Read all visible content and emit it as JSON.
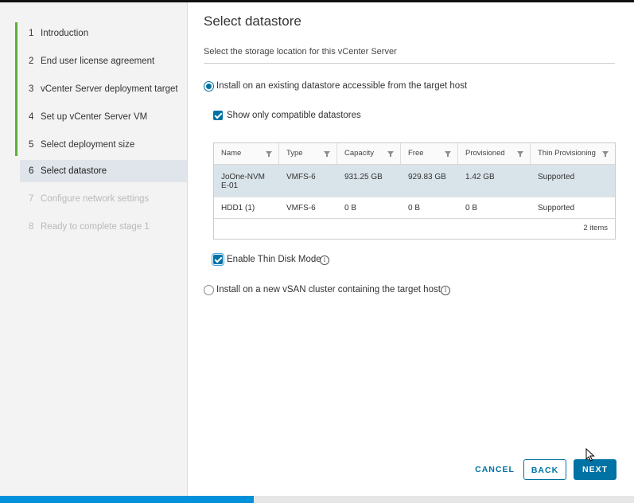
{
  "steps": [
    {
      "num": "1",
      "label": "Introduction",
      "state": "done"
    },
    {
      "num": "2",
      "label": "End user license agreement",
      "state": "done"
    },
    {
      "num": "3",
      "label": "vCenter Server deployment target",
      "state": "done"
    },
    {
      "num": "4",
      "label": "Set up vCenter Server VM",
      "state": "done"
    },
    {
      "num": "5",
      "label": "Select deployment size",
      "state": "done"
    },
    {
      "num": "6",
      "label": "Select datastore",
      "state": "active"
    },
    {
      "num": "7",
      "label": "Configure network settings",
      "state": "future"
    },
    {
      "num": "8",
      "label": "Ready to complete stage 1",
      "state": "future"
    }
  ],
  "page": {
    "title": "Select datastore",
    "subtitle": "Select the storage location for this vCenter Server"
  },
  "options": {
    "existing_datastore": {
      "label": "Install on an existing datastore accessible from the target host",
      "selected": true
    },
    "compatible_only": {
      "label": "Show only compatible datastores",
      "checked": true
    },
    "thin_disk": {
      "label": "Enable Thin Disk Mode",
      "checked": true
    },
    "vsan_cluster": {
      "label": "Install on a new vSAN cluster containing the target host",
      "selected": false
    }
  },
  "table": {
    "columns": [
      "Name",
      "Type",
      "Capacity",
      "Free",
      "Provisioned",
      "Thin Provisioning"
    ],
    "rows": [
      {
        "name_line1": "JoOne-NVM",
        "name_line2": "E-01",
        "type": "VMFS-6",
        "capacity": "931.25 GB",
        "free": "929.83 GB",
        "provisioned": "1.42 GB",
        "thin": "Supported"
      },
      {
        "name_line1": "HDD1 (1)",
        "name_line2": "",
        "type": "VMFS-6",
        "capacity": "0 B",
        "free": "0 B",
        "provisioned": "0 B",
        "thin": "Supported"
      }
    ],
    "item_count": "2  items"
  },
  "buttons": {
    "cancel": "CANCEL",
    "back": "BACK",
    "next": "NEXT"
  },
  "progress": {
    "fraction": 0.4
  },
  "colors": {
    "accent": "#0072a3",
    "done_bar": "#5fae36",
    "progress": "#0091da"
  }
}
